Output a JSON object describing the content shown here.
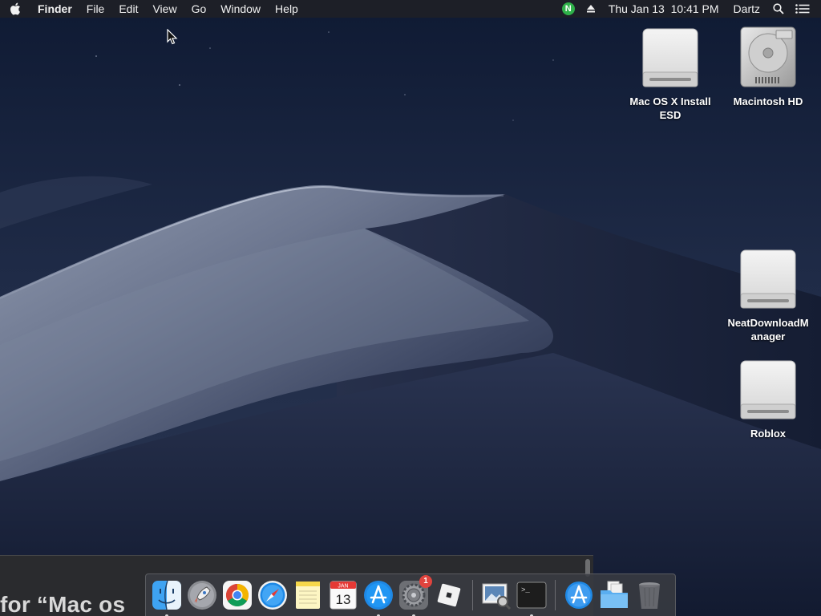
{
  "menubar": {
    "app_name": "Finder",
    "menus": [
      "File",
      "Edit",
      "View",
      "Go",
      "Window",
      "Help"
    ],
    "status": {
      "extension_badge_letter": "N",
      "datetime": "Thu Jan 13  10:41 PM",
      "user": "Dartz"
    },
    "icons": {
      "apple": "apple-logo-icon",
      "eject": "eject-icon",
      "search": "spotlight-search-icon",
      "notifications": "notification-center-icon"
    }
  },
  "desktop_icons": [
    {
      "label": "Mac OS X Install ESD",
      "type": "external-drive-icon"
    },
    {
      "label": "Macintosh HD",
      "type": "hard-drive-icon"
    },
    {
      "label": "NeatDownloadManager",
      "type": "external-drive-icon"
    },
    {
      "label": "Roblox",
      "type": "external-drive-icon"
    }
  ],
  "background_window": {
    "partial_text": "for “Mac os"
  },
  "dock": {
    "items": [
      {
        "name": "Finder",
        "icon": "finder-icon",
        "running": true
      },
      {
        "name": "Launchpad",
        "icon": "launchpad-icon",
        "running": false
      },
      {
        "name": "Google Chrome",
        "icon": "chrome-icon",
        "running": false
      },
      {
        "name": "Safari",
        "icon": "safari-icon",
        "running": false
      },
      {
        "name": "Notes",
        "icon": "notes-icon",
        "running": false
      },
      {
        "name": "Calendar",
        "icon": "calendar-icon",
        "running": false,
        "calendar_month": "JAN",
        "calendar_day": "13"
      },
      {
        "name": "App Store",
        "icon": "app-store-icon",
        "running": true
      },
      {
        "name": "System Preferences",
        "icon": "system-preferences-icon",
        "running": true,
        "badge": "1"
      },
      {
        "name": "Roblox",
        "icon": "roblox-icon",
        "running": false
      },
      {
        "name": "Preview",
        "icon": "preview-icon",
        "running": false
      },
      {
        "name": "Terminal",
        "icon": "terminal-icon",
        "running": true,
        "prompt": ">_"
      },
      {
        "name": "Applications",
        "icon": "applications-folder-icon",
        "running": false
      },
      {
        "name": "Documents",
        "icon": "documents-folder-icon",
        "running": false
      },
      {
        "name": "Trash",
        "icon": "trash-icon",
        "running": false
      }
    ]
  },
  "colors": {
    "menubar_bg": "#1e2026",
    "dock_bg": "#3a3c42",
    "sky_top": "#0f1a33",
    "sky_bottom": "#2c3855",
    "dune_light": "#9aa3b8",
    "badge_red": "#e0443e",
    "nd_green": "#2fb14a"
  }
}
